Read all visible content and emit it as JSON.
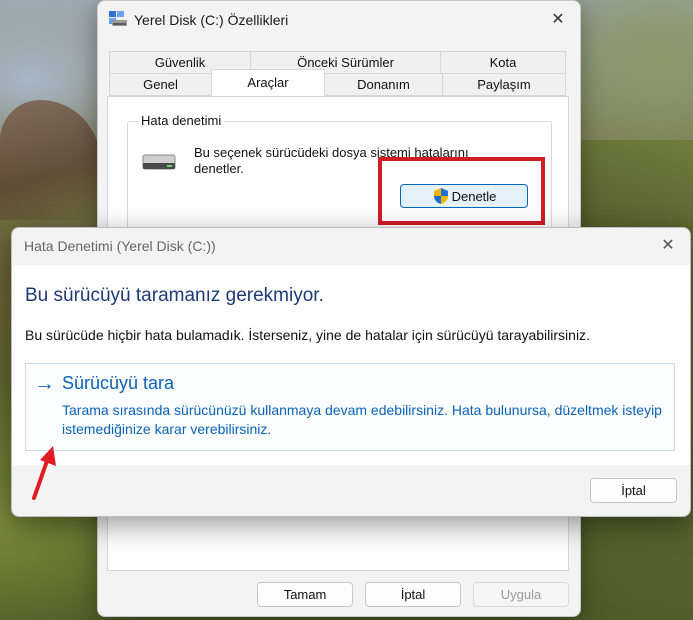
{
  "colors": {
    "accent": "#0a63b6",
    "heading": "#1e3a78",
    "highlight": "#d11d28",
    "button_blue_fill": "#e5f1fb"
  },
  "properties_window": {
    "title": "Yerel Disk (C:) Özellikleri",
    "icons": {
      "title": "drive-properties-icon",
      "close": "close-icon"
    },
    "tabs_row1": [
      "Güvenlik",
      "Önceki Sürümler",
      "Kota"
    ],
    "tabs_row2": [
      "Genel",
      "Araçlar",
      "Donanım",
      "Paylaşım"
    ],
    "active_tab": "Araçlar",
    "group": {
      "label": "Hata denetimi",
      "description": "Bu seçenek sürücüdeki dosya sistemi hatalarını denetler.",
      "button_label": "Denetle",
      "button_icon": "uac-shield-icon",
      "drive_icon": "hard-drive-icon"
    },
    "buttons": {
      "ok": "Tamam",
      "cancel": "İptal",
      "apply": "Uygula"
    }
  },
  "dialog": {
    "title": "Hata Denetimi (Yerel Disk (C:))",
    "heading": "Bu sürücüyü taramanız gerekmiyor.",
    "info": "Bu sürücüde hiçbir hata bulamadık. İsterseniz, yine de hatalar için sürücüyü tarayabilirsiniz.",
    "option": {
      "arrow": "→",
      "title": "Sürücüyü tara",
      "description": "Tarama sırasında sürücünüzü kullanmaya devam edebilirsiniz. Hata bulunursa, düzeltmek isteyip istemediğinize karar verebilirsiniz."
    },
    "cancel_label": "İptal",
    "close_icon": "close-icon"
  },
  "annotations": {
    "highlight": "red-highlight-box",
    "pointer": "red-arrow"
  }
}
